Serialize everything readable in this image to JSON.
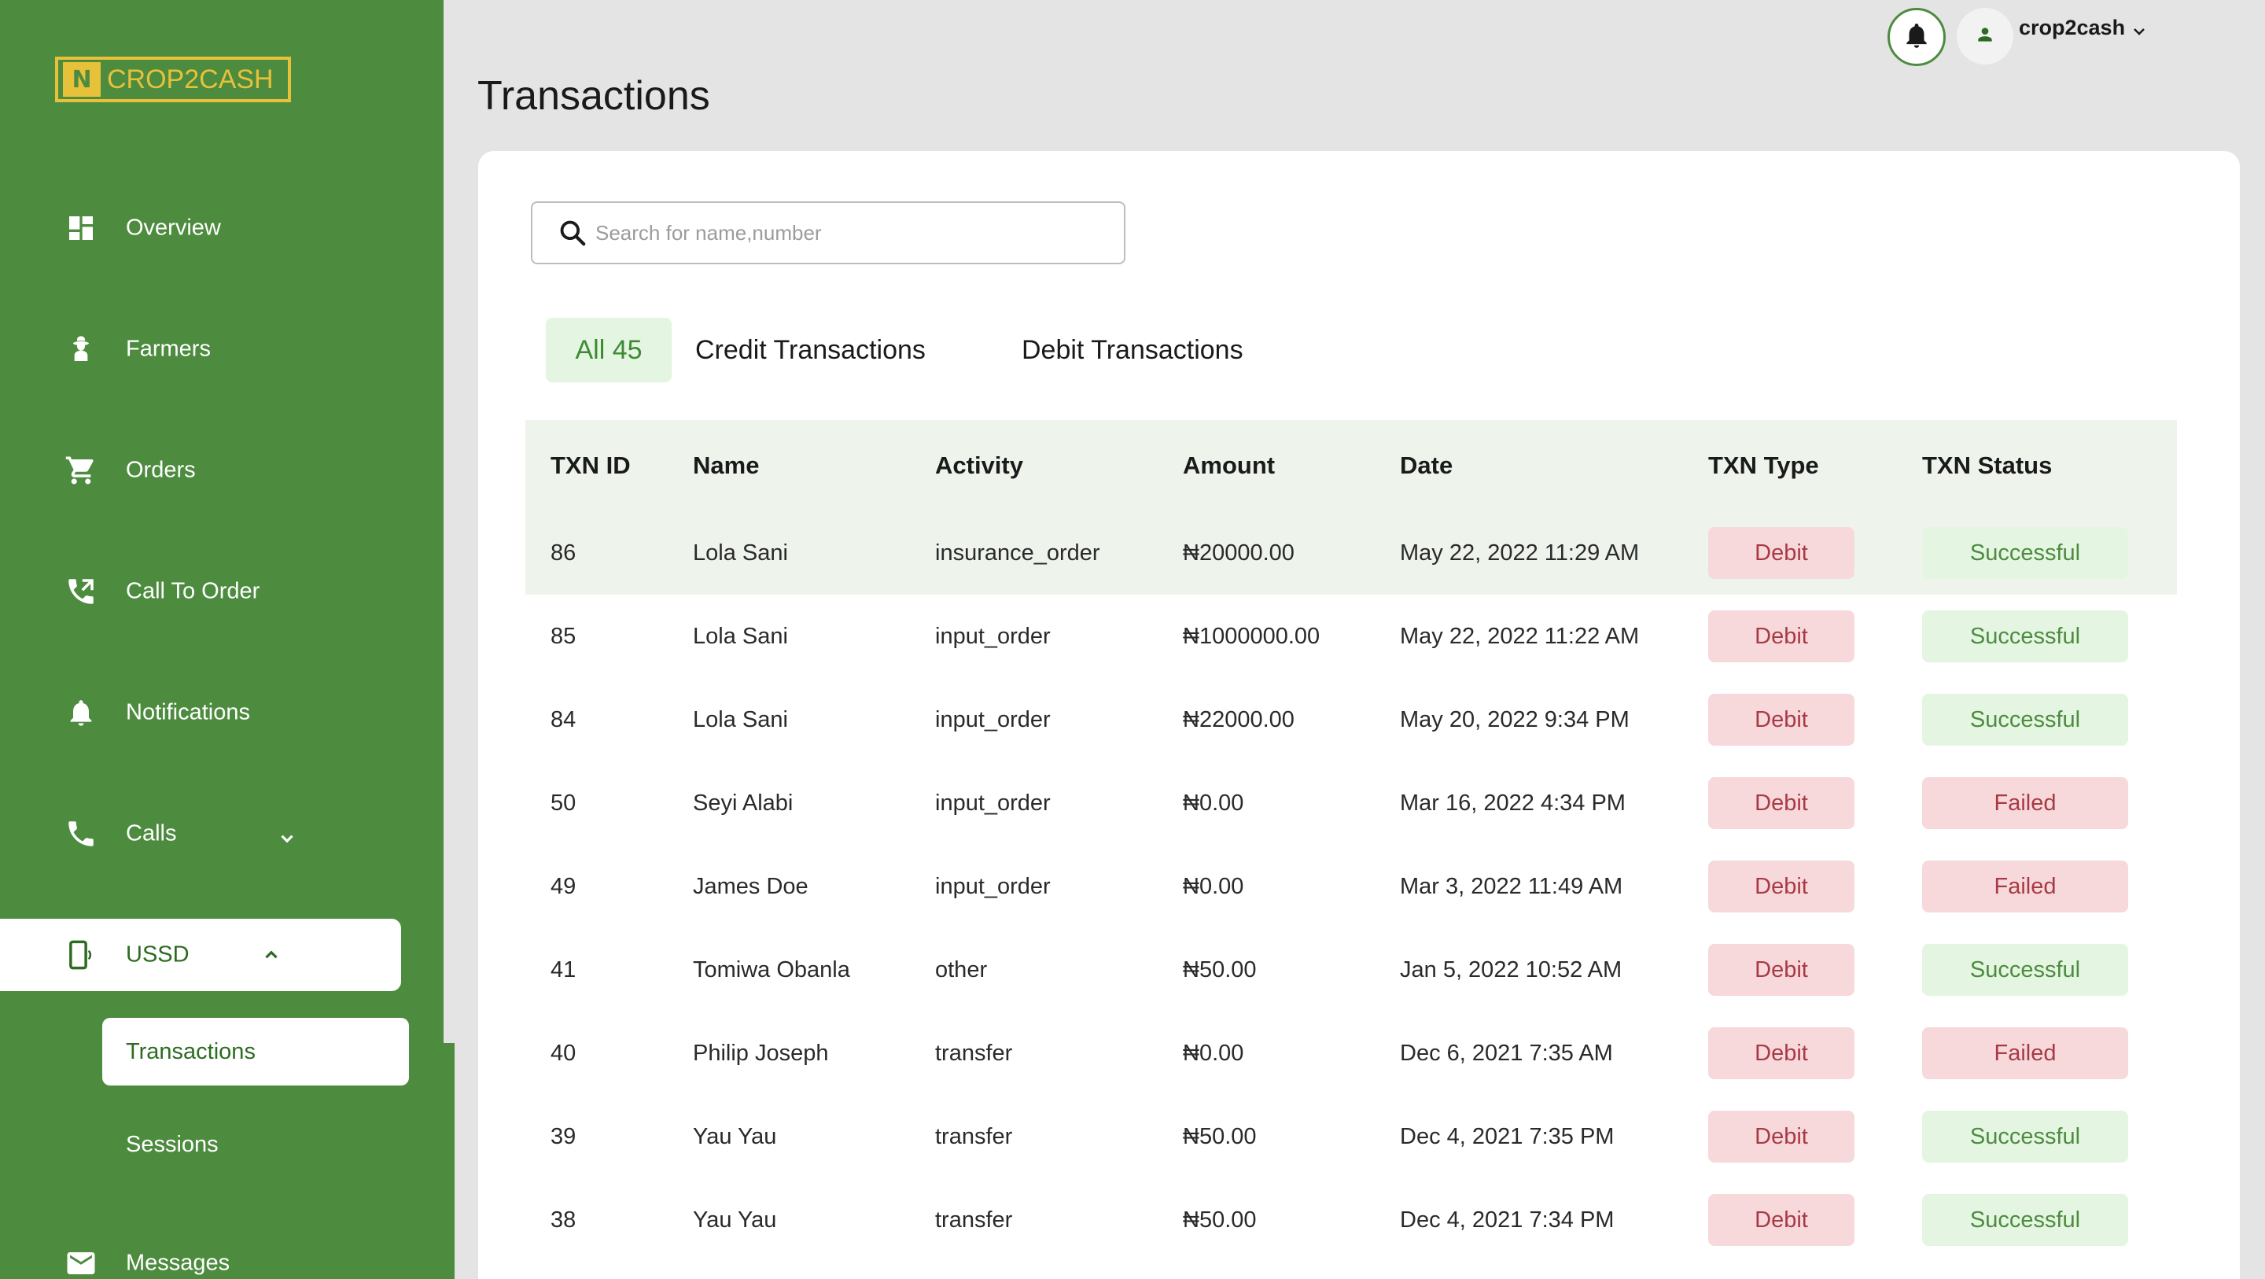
{
  "brand": {
    "logo_text": "CROP2CASH",
    "logo_mark": "N",
    "accent": "#4d8b3f",
    "logo_color": "#e8c13a"
  },
  "sidebar": {
    "items": [
      {
        "label": "Overview",
        "icon": "dashboard-icon"
      },
      {
        "label": "Farmers",
        "icon": "farmer-icon"
      },
      {
        "label": "Orders",
        "icon": "cart-icon"
      },
      {
        "label": "Call To Order",
        "icon": "phone-forward-icon"
      },
      {
        "label": "Notifications",
        "icon": "bell-icon"
      },
      {
        "label": "Calls",
        "icon": "phone-icon",
        "expandable": true,
        "expanded": false
      },
      {
        "label": "USSD",
        "icon": "mobile-icon",
        "expandable": true,
        "expanded": true,
        "active": true
      },
      {
        "label": "Messages",
        "icon": "mail-icon"
      }
    ],
    "ussd_sub": [
      {
        "label": "Transactions",
        "active": true
      },
      {
        "label": "Sessions",
        "active": false
      }
    ]
  },
  "header": {
    "user_name": "crop2cash"
  },
  "page": {
    "title": "Transactions"
  },
  "search": {
    "placeholder": "Search for name,number",
    "value": ""
  },
  "tabs": [
    {
      "label": "All 45",
      "active": true
    },
    {
      "label": "Credit Transactions",
      "active": false
    },
    {
      "label": "Debit Transactions",
      "active": false
    }
  ],
  "table": {
    "headers": [
      "TXN ID",
      "Name",
      "Activity",
      "Amount",
      "Date",
      "TXN Type",
      "TXN Status"
    ],
    "rows": [
      {
        "id": "86",
        "name": "Lola Sani",
        "activity": "insurance_order",
        "amount": "₦20000.00",
        "date": "May 22, 2022 11:29 AM",
        "type": "Debit",
        "status": "Successful"
      },
      {
        "id": "85",
        "name": "Lola Sani",
        "activity": "input_order",
        "amount": "₦1000000.00",
        "date": "May 22, 2022 11:22 AM",
        "type": "Debit",
        "status": "Successful"
      },
      {
        "id": "84",
        "name": "Lola Sani",
        "activity": "input_order",
        "amount": "₦22000.00",
        "date": "May 20, 2022 9:34 PM",
        "type": "Debit",
        "status": "Successful"
      },
      {
        "id": "50",
        "name": "Seyi Alabi",
        "activity": "input_order",
        "amount": "₦0.00",
        "date": "Mar 16, 2022 4:34 PM",
        "type": "Debit",
        "status": "Failed"
      },
      {
        "id": "49",
        "name": "James Doe",
        "activity": "input_order",
        "amount": "₦0.00",
        "date": "Mar 3, 2022 11:49 AM",
        "type": "Debit",
        "status": "Failed"
      },
      {
        "id": "41",
        "name": "Tomiwa Obanla",
        "activity": "other",
        "amount": "₦50.00",
        "date": "Jan 5, 2022 10:52 AM",
        "type": "Debit",
        "status": "Successful"
      },
      {
        "id": "40",
        "name": "Philip Joseph",
        "activity": "transfer",
        "amount": "₦0.00",
        "date": "Dec 6, 2021 7:35 AM",
        "type": "Debit",
        "status": "Failed"
      },
      {
        "id": "39",
        "name": "Yau Yau",
        "activity": "transfer",
        "amount": "₦50.00",
        "date": "Dec 4, 2021 7:35 PM",
        "type": "Debit",
        "status": "Successful"
      },
      {
        "id": "38",
        "name": "Yau Yau",
        "activity": "transfer",
        "amount": "₦50.00",
        "date": "Dec 4, 2021 7:34 PM",
        "type": "Debit",
        "status": "Successful"
      }
    ]
  }
}
